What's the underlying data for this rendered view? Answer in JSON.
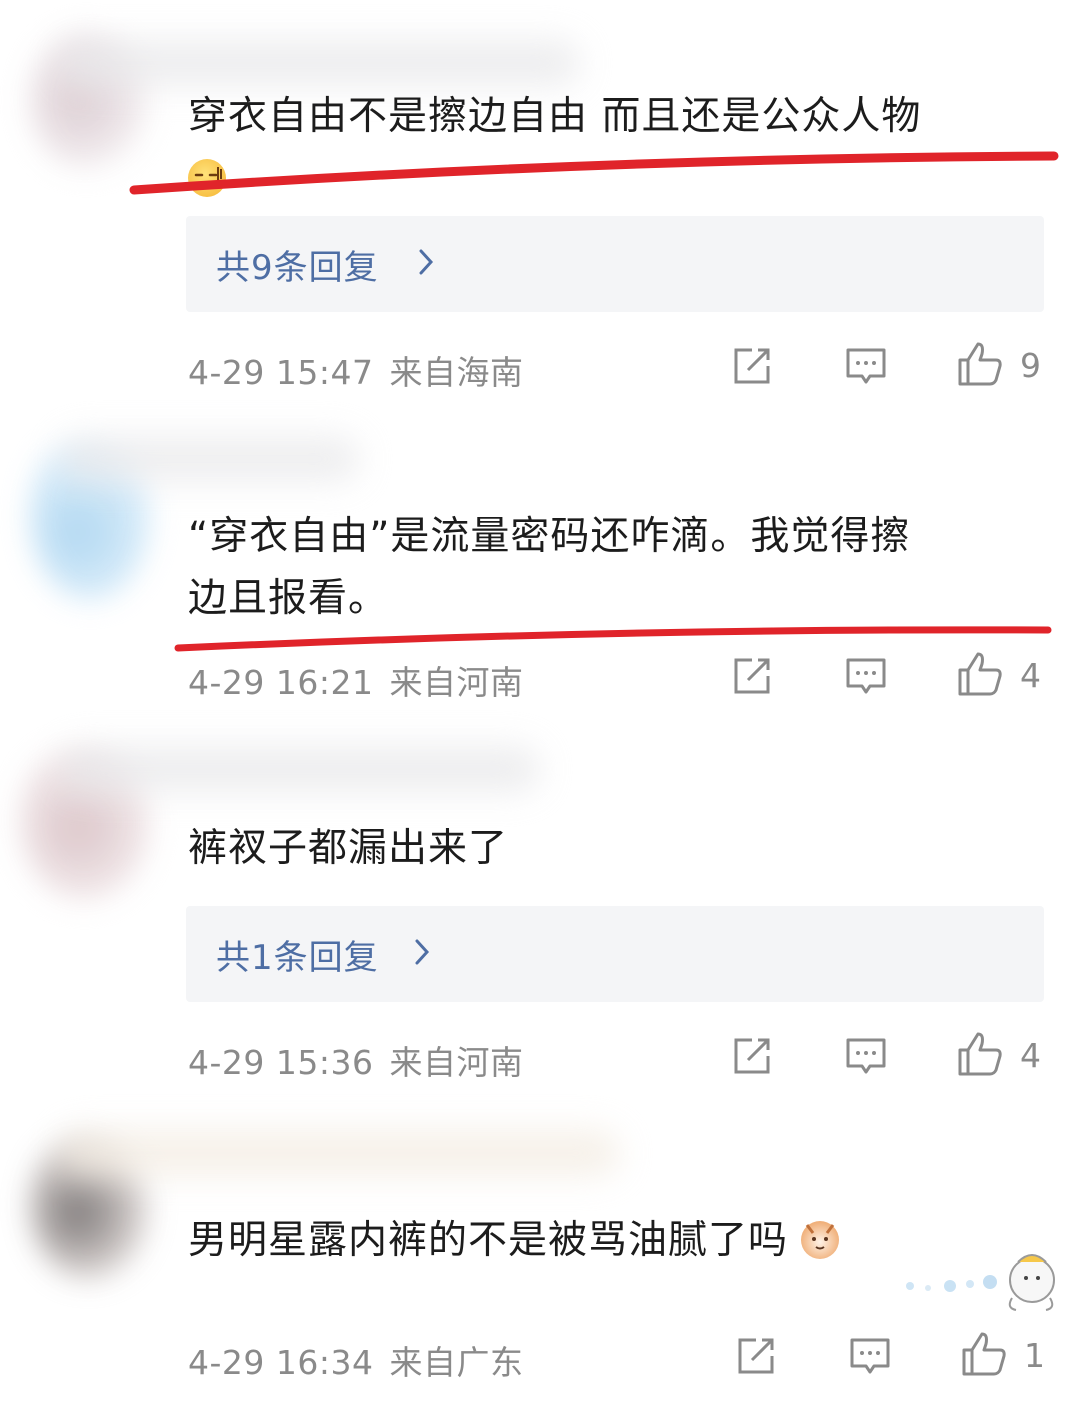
{
  "colors": {
    "underline": "#e0242a",
    "reply_text": "#4e6ea4",
    "meta_text": "#8a8a8a",
    "reply_bg": "#f4f5f7"
  },
  "comments": [
    {
      "text_lines": [
        "穿衣自由不是擦边自由 而且还是公众人物"
      ],
      "emoji": "dizzy-face-emoji",
      "reply_label": "共9条回复",
      "date": "4-29 15:47",
      "location": "来自海南",
      "like_count": "9"
    },
    {
      "text_lines": [
        "“穿衣自由”是流量密码还咋滴。我觉得擦",
        "边且报看。"
      ],
      "date": "4-29 16:21",
      "location": "来自河南",
      "like_count": "4"
    },
    {
      "text_lines": [
        "裤衩子都漏出来了"
      ],
      "reply_label": "共1条回复",
      "date": "4-29 15:36",
      "location": "来自河南",
      "like_count": "4"
    },
    {
      "text_lines": [
        "男明星露内裤的不是被骂油腻了吗"
      ],
      "emoji": "cat-face-emoji",
      "date": "4-29 16:34",
      "location": "来自广东",
      "like_count": "1"
    }
  ],
  "icons": {
    "share": "share-icon",
    "comment": "comment-icon",
    "like": "thumbs-up-icon",
    "chevron": "chevron-right-icon"
  }
}
